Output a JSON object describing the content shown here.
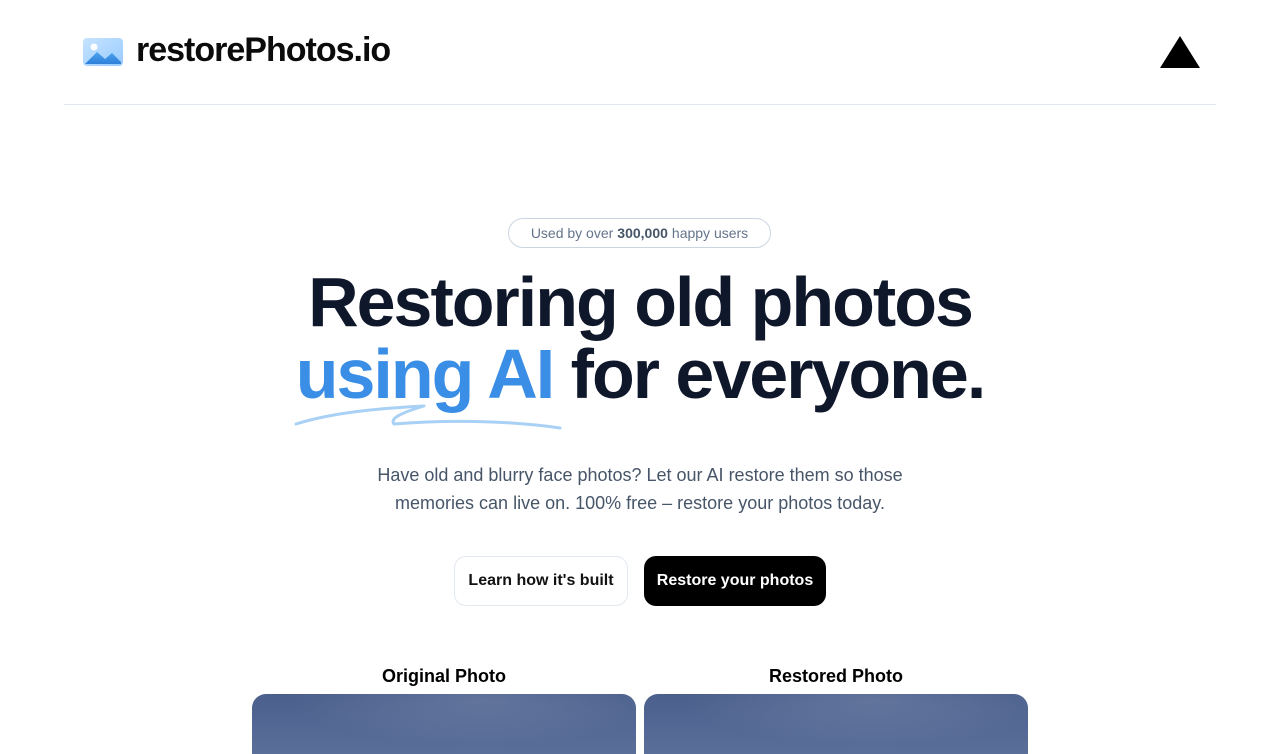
{
  "header": {
    "brand_name": "restorePhotos.io",
    "logo_icon": "photo-icon",
    "vercel_icon": "vercel-triangle-icon"
  },
  "hero": {
    "badge_prefix": "Used by over",
    "badge_count": "300,000",
    "badge_suffix": "happy users",
    "headline_line1": "Restoring old photos",
    "headline_accent": "using AI",
    "headline_rest": "for everyone.",
    "subtitle": "Have old and blurry face photos? Let our AI restore them so those memories can live on. 100% free – restore your photos today.",
    "learn_button": "Learn how it's built",
    "restore_button": "Restore your photos"
  },
  "comparison": {
    "original_label": "Original Photo",
    "restored_label": "Restored Photo"
  },
  "colors": {
    "accent": "#3a8ee6",
    "headline": "#0f172a",
    "primary_button": "#000000"
  }
}
